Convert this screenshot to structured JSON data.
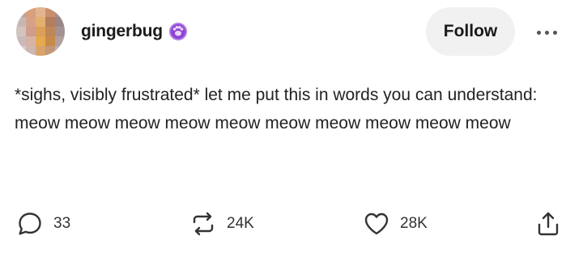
{
  "post": {
    "username": "gingerbug",
    "follow_label": "Follow",
    "text": "*sighs, visibly frustrated* let me put this in words you can understand: meow meow meow meow meow meow meow meow meow meow",
    "actions": {
      "replies": "33",
      "reblogs": "24K",
      "likes": "28K"
    }
  },
  "icons": {
    "badge": "purple-paw-badge-icon",
    "more": "more-dots-icon",
    "reply": "speech-bubble-icon",
    "reblog": "reblog-arrows-icon",
    "like": "heart-outline-icon",
    "share": "share-upload-icon"
  },
  "colors": {
    "follow_bg": "#f1f1f1",
    "badge": "#9b59d6",
    "text": "#222222"
  }
}
